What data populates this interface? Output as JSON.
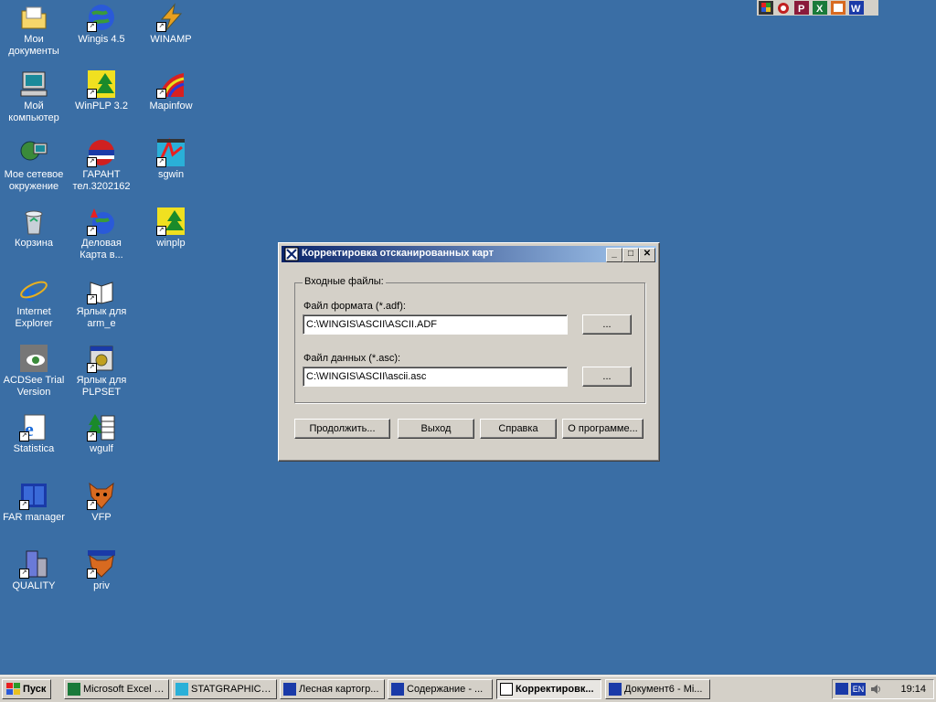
{
  "desktop": {
    "icons": [
      {
        "label": "Мои документы",
        "icon": "folder-icon"
      },
      {
        "label": "Мой компьютер",
        "icon": "computer-icon"
      },
      {
        "label": "Мое сетевое окружение",
        "icon": "network-icon"
      },
      {
        "label": "Корзина",
        "icon": "recycle-bin-icon"
      },
      {
        "label": "Internet Explorer",
        "icon": "ie-icon"
      },
      {
        "label": "ACDSee Trial Version",
        "icon": "acdsee-icon"
      },
      {
        "label": "Statistica",
        "icon": "statistica-icon"
      },
      {
        "label": "FAR manager",
        "icon": "far-icon"
      },
      {
        "label": "QUALITY",
        "icon": "quality-icon"
      },
      {
        "label": "Wingis 4.5",
        "icon": "globe-icon"
      },
      {
        "label": "WinPLP 3.2",
        "icon": "tree-map-icon"
      },
      {
        "label": "ГАРАНТ тел.3202162",
        "icon": "garant-icon"
      },
      {
        "label": "Деловая Карта в...",
        "icon": "map-globe-icon"
      },
      {
        "label": "Ярлык для arm_e",
        "icon": "book-icon"
      },
      {
        "label": "Ярлык для PLPSET",
        "icon": "settings-icon"
      },
      {
        "label": "wgulf",
        "icon": "tree-table-icon"
      },
      {
        "label": "VFP",
        "icon": "fox-icon"
      },
      {
        "label": "priv",
        "icon": "fox-icon"
      },
      {
        "label": "WINAMP",
        "icon": "winamp-icon"
      },
      {
        "label": "Mapinfow",
        "icon": "mapinfo-icon"
      },
      {
        "label": "sgwin",
        "icon": "sgwin-icon"
      },
      {
        "label": "winplp",
        "icon": "tree-map-icon"
      }
    ]
  },
  "dialog": {
    "title": "Корректировка отсканированных карт",
    "group_label": "Входные файлы:",
    "format_label": "Файл формата (*.adf):",
    "format_value": "C:\\WINGIS\\ASCII\\ASCII.ADF",
    "data_label": "Файл данных (*.asc):",
    "data_value": "C:\\WINGIS\\ASCII\\ascii.asc",
    "browse_label": "...",
    "buttons": {
      "continue": "Продолжить...",
      "exit": "Выход",
      "help": "Справка",
      "about": "О программе..."
    },
    "min": "_",
    "max": "□",
    "close": "✕"
  },
  "taskbar": {
    "start": "Пуск",
    "tasks": [
      {
        "label": "Microsoft Excel - ...",
        "icon": "excel-icon"
      },
      {
        "label": "STATGRAPHICS ...",
        "icon": "statgraphics-icon"
      },
      {
        "label": "Лесная картогр...",
        "icon": "word-icon"
      },
      {
        "label": "Содержание - ...",
        "icon": "word-icon"
      },
      {
        "label": "Корректировк...",
        "icon": "app-icon"
      },
      {
        "label": "Документ6 - Mi...",
        "icon": "word-icon"
      }
    ],
    "lang": "EN",
    "clock": "19:14"
  }
}
